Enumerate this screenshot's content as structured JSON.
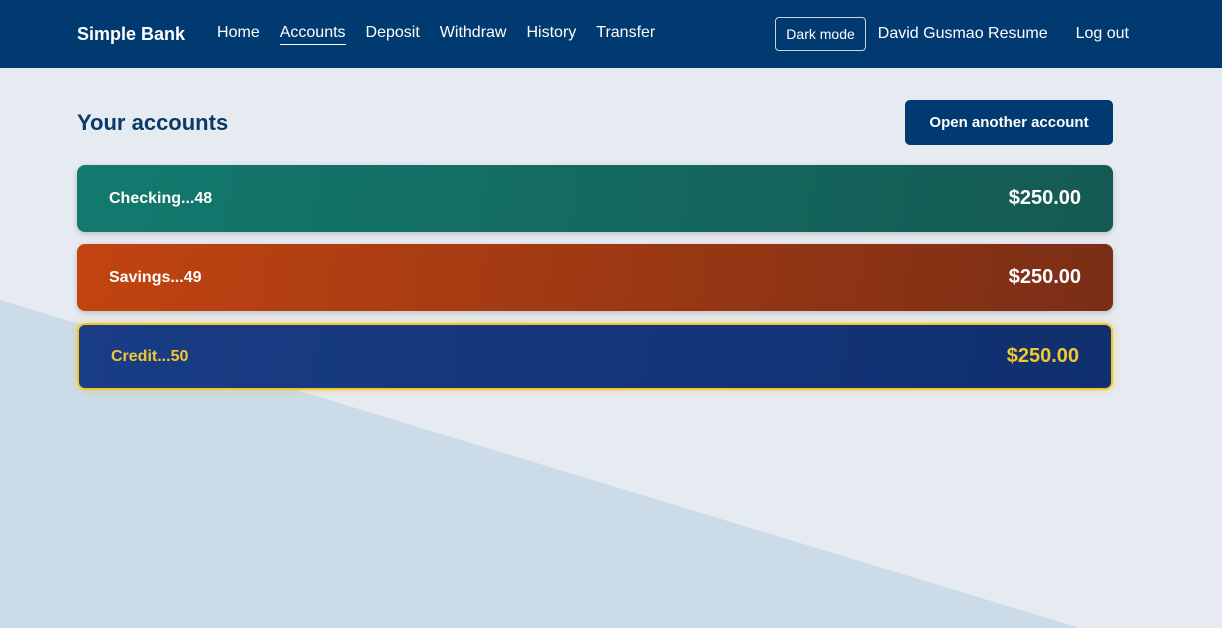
{
  "nav": {
    "brand": "Simple Bank",
    "links": [
      "Home",
      "Accounts",
      "Deposit",
      "Withdraw",
      "History",
      "Transfer"
    ],
    "active": "Accounts",
    "dark_mode": "Dark mode",
    "user": "David Gusmao Resume",
    "logout": "Log out"
  },
  "main": {
    "title": "Your accounts",
    "open_button": "Open another account",
    "accounts": [
      {
        "name": "Checking...48",
        "balance": "$250.00"
      },
      {
        "name": "Savings...49",
        "balance": "$250.00"
      },
      {
        "name": "Credit...50",
        "balance": "$250.00"
      }
    ]
  },
  "colors": {
    "navbar": "#003a70",
    "checking": "#137a6f",
    "savings": "#c24410",
    "credit": "#193d86",
    "credit_accent": "#f2c52d"
  }
}
